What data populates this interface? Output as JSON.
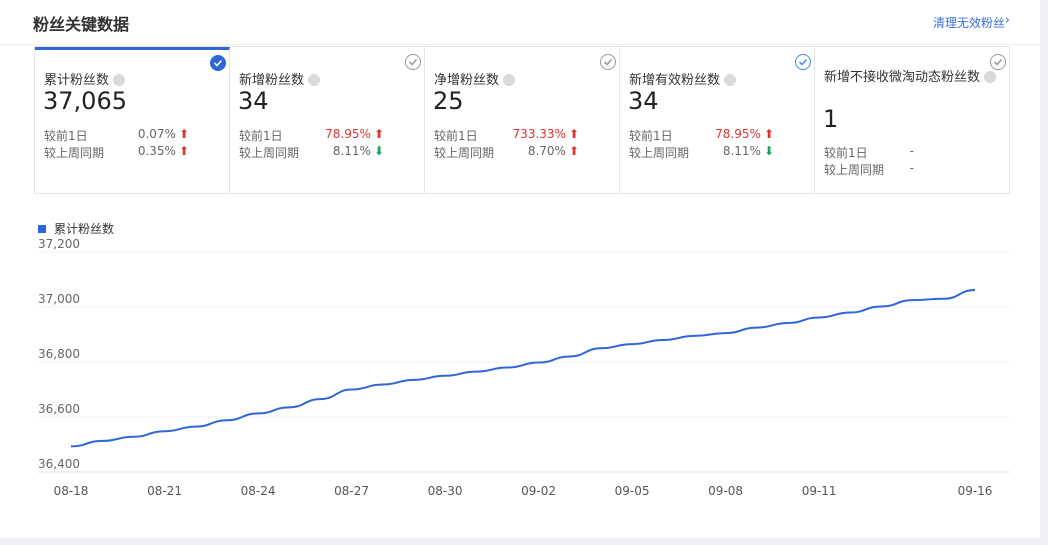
{
  "header": {
    "title": "粉丝关键数据",
    "link_label": "清理无效粉丝",
    "chevron_icon": "chevron-right-icon"
  },
  "cards": [
    {
      "label": "累计粉丝数",
      "value": "37,065",
      "selected": true,
      "rows": [
        {
          "label": "较前1日",
          "pct": "0.07%",
          "trend": "up",
          "color": "gray"
        },
        {
          "label": "较上周同期",
          "pct": "0.35%",
          "trend": "up",
          "color": "gray"
        }
      ]
    },
    {
      "label": "新增粉丝数",
      "value": "34",
      "selected": false,
      "rows": [
        {
          "label": "较前1日",
          "pct": "78.95%",
          "trend": "up",
          "color": "red"
        },
        {
          "label": "较上周同期",
          "pct": "8.11%",
          "trend": "down",
          "color": "gray"
        }
      ]
    },
    {
      "label": "净增粉丝数",
      "value": "25",
      "selected": false,
      "rows": [
        {
          "label": "较前1日",
          "pct": "733.33%",
          "trend": "up",
          "color": "red"
        },
        {
          "label": "较上周同期",
          "pct": "8.70%",
          "trend": "up",
          "color": "gray"
        }
      ]
    },
    {
      "label": "新增有效粉丝数",
      "value": "34",
      "selected": false,
      "rows": [
        {
          "label": "较前1日",
          "pct": "78.95%",
          "trend": "up",
          "color": "red"
        },
        {
          "label": "较上周同期",
          "pct": "8.11%",
          "trend": "down",
          "color": "gray"
        }
      ]
    },
    {
      "label": "新增不接收微淘动态粉丝数",
      "value": "1",
      "selected": false,
      "rows": [
        {
          "label": "较前1日",
          "pct": "-",
          "trend": "none",
          "color": "gray"
        },
        {
          "label": "较上周同期",
          "pct": "-",
          "trend": "none",
          "color": "gray"
        }
      ]
    }
  ],
  "chart_data": {
    "type": "line",
    "legend": "top-left",
    "grid": true,
    "series": [
      {
        "name": "累计粉丝数",
        "color": "#2f66d8",
        "x": [
          "08-18",
          "08-19",
          "08-20",
          "08-21",
          "08-22",
          "08-23",
          "08-24",
          "08-25",
          "08-26",
          "08-27",
          "08-28",
          "08-29",
          "08-30",
          "08-31",
          "09-01",
          "09-02",
          "09-03",
          "09-04",
          "09-05",
          "09-06",
          "09-07",
          "09-08",
          "09-09",
          "09-10",
          "09-11",
          "09-12",
          "09-13",
          "09-14",
          "09-15",
          "09-16"
        ],
        "values": [
          36493,
          36513,
          36528,
          36548,
          36565,
          36588,
          36613,
          36635,
          36665,
          36700,
          36718,
          36735,
          36750,
          36765,
          36780,
          36798,
          36820,
          36850,
          36865,
          36880,
          36895,
          36905,
          36925,
          36942,
          36962,
          36980,
          37002,
          37025,
          37030,
          37062
        ]
      }
    ],
    "xticks": [
      "08-18",
      "08-21",
      "08-24",
      "08-27",
      "08-30",
      "09-02",
      "09-05",
      "09-08",
      "09-11",
      "09-16"
    ],
    "yticks": [
      "36,400",
      "36,600",
      "36,800",
      "37,000",
      "37,200"
    ],
    "ylim": [
      36400,
      37200
    ]
  }
}
